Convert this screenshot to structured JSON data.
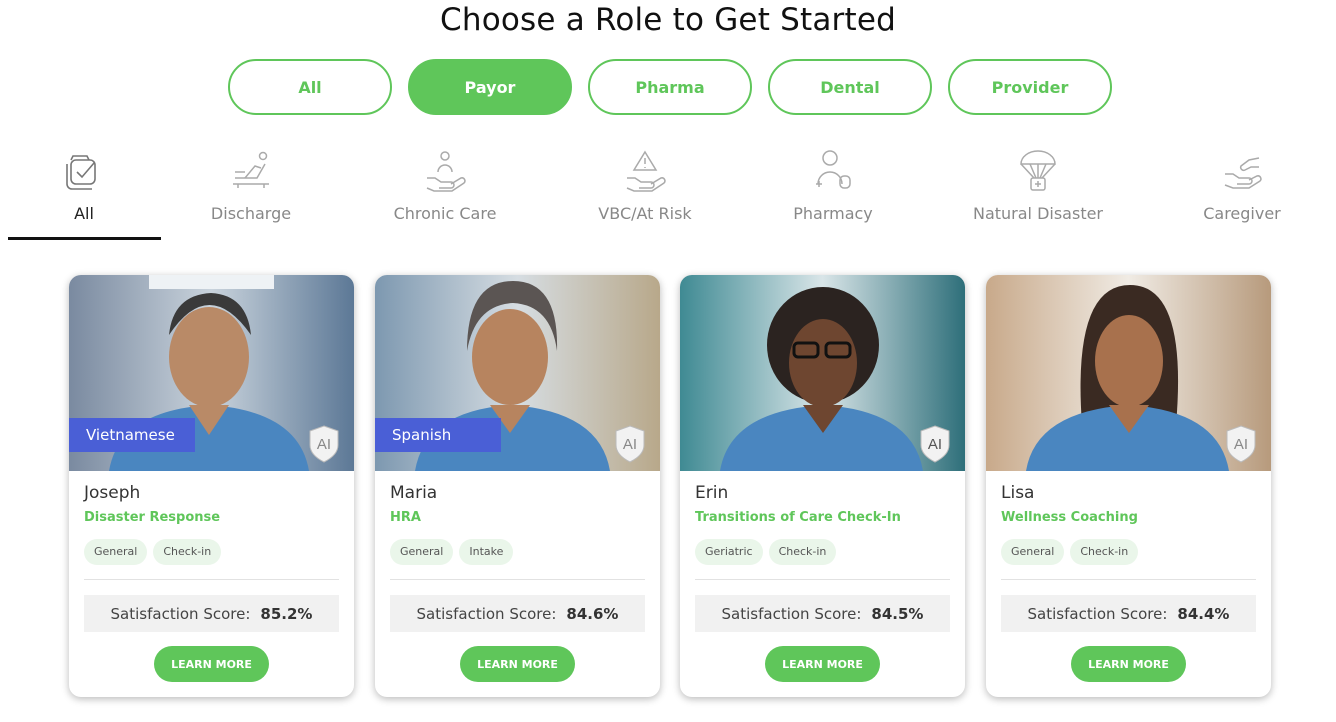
{
  "page": {
    "title": "Choose a Role to Get Started"
  },
  "role_tabs": [
    {
      "label": "All",
      "active": false
    },
    {
      "label": "Payor",
      "active": true
    },
    {
      "label": "Pharma",
      "active": false
    },
    {
      "label": "Dental",
      "active": false
    },
    {
      "label": "Provider",
      "active": false
    }
  ],
  "category_tabs": [
    {
      "label": "All",
      "icon": "checklist-icon",
      "active": true
    },
    {
      "label": "Discharge",
      "icon": "hospital-bed-icon",
      "active": false
    },
    {
      "label": "Chronic Care",
      "icon": "hand-person-icon",
      "active": false
    },
    {
      "label": "VBC/At Risk",
      "icon": "hand-warning-icon",
      "active": false
    },
    {
      "label": "Pharmacy",
      "icon": "pharmacist-icon",
      "active": false
    },
    {
      "label": "Natural Disaster",
      "icon": "parachute-aid-icon",
      "active": false
    },
    {
      "label": "Caregiver",
      "icon": "helping-hands-icon",
      "active": false
    }
  ],
  "cards": [
    {
      "name": "Joseph",
      "role": "Disaster Response",
      "language": "Vietnamese",
      "tags": [
        "General",
        "Check-in"
      ],
      "score_label": "Satisfaction Score:",
      "score_value": "85.2%",
      "button": "LEARN MORE",
      "ai_label": "AI"
    },
    {
      "name": "Maria",
      "role": "HRA",
      "language": "Spanish",
      "tags": [
        "General",
        "Intake"
      ],
      "score_label": "Satisfaction Score:",
      "score_value": "84.6%",
      "button": "LEARN MORE",
      "ai_label": "AI"
    },
    {
      "name": "Erin",
      "role": "Transitions of Care Check-In",
      "language": "",
      "tags": [
        "Geriatric",
        "Check-in"
      ],
      "score_label": "Satisfaction Score:",
      "score_value": "84.5%",
      "button": "LEARN MORE",
      "ai_label": "AI"
    },
    {
      "name": "Lisa",
      "role": "Wellness Coaching",
      "language": "",
      "tags": [
        "General",
        "Check-in"
      ],
      "score_label": "Satisfaction Score:",
      "score_value": "84.4%",
      "button": "LEARN MORE",
      "ai_label": "AI"
    }
  ],
  "colors": {
    "accent": "#5fc65a",
    "language_badge": "#4a5fd6",
    "tag_bg": "#eaf6ea"
  }
}
